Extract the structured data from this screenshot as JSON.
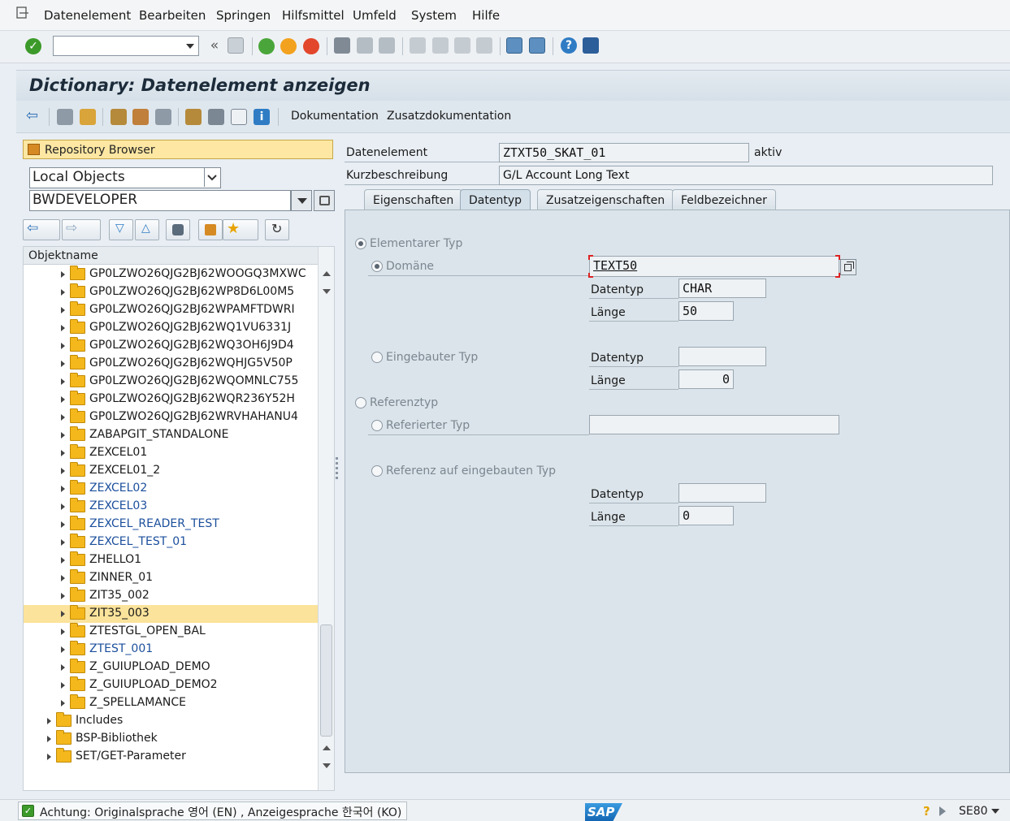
{
  "menu": {
    "items": [
      "Datenelement",
      "Bearbeiten",
      "Springen",
      "Hilfsmittel",
      "Umfeld",
      "System",
      "Hilfe"
    ]
  },
  "toolbar": {
    "command_value": "",
    "icons": [
      "check-icon",
      "back-icon",
      "save-icon",
      "back-green-icon",
      "exit-icon",
      "cancel-icon",
      "print-icon",
      "find-icon",
      "find-next-icon",
      "first-page-icon",
      "prev-page-icon",
      "next-page-icon",
      "last-page-icon",
      "new-session-icon",
      "shortcut-icon",
      "help-icon",
      "customize-icon"
    ]
  },
  "title": "Dictionary: Datenelement anzeigen",
  "app_toolbar": {
    "doc_label": "Dokumentation",
    "extra_doc_label": "Zusatzdokumentation"
  },
  "left": {
    "repo_browser_label": "Repository Browser",
    "object_type": "Local Objects",
    "user": "BWDEVELOPER",
    "tree_header": "Objektname",
    "tree_items": [
      {
        "label": "GP0LZWO26QJG2BJ62WOOGQ3MXWC",
        "level": 2,
        "blue": false,
        "selected": false
      },
      {
        "label": "GP0LZWO26QJG2BJ62WP8D6L00M5",
        "level": 2,
        "blue": false,
        "selected": false
      },
      {
        "label": "GP0LZWO26QJG2BJ62WPAMFTDWRI",
        "level": 2,
        "blue": false,
        "selected": false
      },
      {
        "label": "GP0LZWO26QJG2BJ62WQ1VU6331J",
        "level": 2,
        "blue": false,
        "selected": false
      },
      {
        "label": "GP0LZWO26QJG2BJ62WQ3OH6J9D4",
        "level": 2,
        "blue": false,
        "selected": false
      },
      {
        "label": "GP0LZWO26QJG2BJ62WQHJG5V50P",
        "level": 2,
        "blue": false,
        "selected": false
      },
      {
        "label": "GP0LZWO26QJG2BJ62WQOMNLC755",
        "level": 2,
        "blue": false,
        "selected": false
      },
      {
        "label": "GP0LZWO26QJG2BJ62WQR236Y52H",
        "level": 2,
        "blue": false,
        "selected": false
      },
      {
        "label": "GP0LZWO26QJG2BJ62WRVHAHANU4",
        "level": 2,
        "blue": false,
        "selected": false
      },
      {
        "label": "ZABAPGIT_STANDALONE",
        "level": 2,
        "blue": false,
        "selected": false
      },
      {
        "label": "ZEXCEL01",
        "level": 2,
        "blue": false,
        "selected": false
      },
      {
        "label": "ZEXCEL01_2",
        "level": 2,
        "blue": false,
        "selected": false
      },
      {
        "label": "ZEXCEL02",
        "level": 2,
        "blue": true,
        "selected": false
      },
      {
        "label": "ZEXCEL03",
        "level": 2,
        "blue": true,
        "selected": false
      },
      {
        "label": "ZEXCEL_READER_TEST",
        "level": 2,
        "blue": true,
        "selected": false
      },
      {
        "label": "ZEXCEL_TEST_01",
        "level": 2,
        "blue": true,
        "selected": false
      },
      {
        "label": "ZHELLO1",
        "level": 2,
        "blue": false,
        "selected": false
      },
      {
        "label": "ZINNER_01",
        "level": 2,
        "blue": false,
        "selected": false
      },
      {
        "label": "ZIT35_002",
        "level": 2,
        "blue": false,
        "selected": false
      },
      {
        "label": "ZIT35_003",
        "level": 2,
        "blue": false,
        "selected": true
      },
      {
        "label": "ZTESTGL_OPEN_BAL",
        "level": 2,
        "blue": false,
        "selected": false
      },
      {
        "label": "ZTEST_001",
        "level": 2,
        "blue": true,
        "selected": false
      },
      {
        "label": "Z_GUIUPLOAD_DEMO",
        "level": 2,
        "blue": false,
        "selected": false
      },
      {
        "label": "Z_GUIUPLOAD_DEMO2",
        "level": 2,
        "blue": false,
        "selected": false
      },
      {
        "label": "Z_SPELLAMANCE",
        "level": 2,
        "blue": false,
        "selected": false
      },
      {
        "label": "Includes",
        "level": 1,
        "blue": false,
        "selected": false
      },
      {
        "label": "BSP-Bibliothek",
        "level": 1,
        "blue": false,
        "selected": false
      },
      {
        "label": "SET/GET-Parameter",
        "level": 1,
        "blue": false,
        "selected": false
      }
    ]
  },
  "right": {
    "datenelement_label": "Datenelement",
    "datenelement_value": "ZTXT50_SKAT_01",
    "status": "aktiv",
    "kurz_label": "Kurzbeschreibung",
    "kurz_value": "G/L Account Long Text",
    "tabs": [
      "Eigenschaften",
      "Datentyp",
      "Zusatzeigenschaften",
      "Feldbezeichner"
    ],
    "active_tab": "Datentyp",
    "elementarer_typ": "Elementarer Typ",
    "domaene": "Domäne",
    "domaene_value": "TEXT50",
    "datentyp_label": "Datentyp",
    "laenge_label": "Länge",
    "dom_datentyp": "CHAR",
    "dom_laenge": "50",
    "eingebauter_typ": "Eingebauter Typ",
    "eing_datentyp": "",
    "eing_laenge": "0",
    "referenztyp": "Referenztyp",
    "referierter_typ": "Referierter Typ",
    "ref_value": "",
    "ref_eingebaut": "Referenz auf eingebauten Typ",
    "ref_datentyp": "",
    "ref_laenge": "0"
  },
  "status_bar": {
    "message": "Achtung: Originalsprache 영어 (EN) , Anzeigesprache 한국어 (KO)",
    "sap_logo_text": "SAP",
    "transaction": "SE80"
  }
}
